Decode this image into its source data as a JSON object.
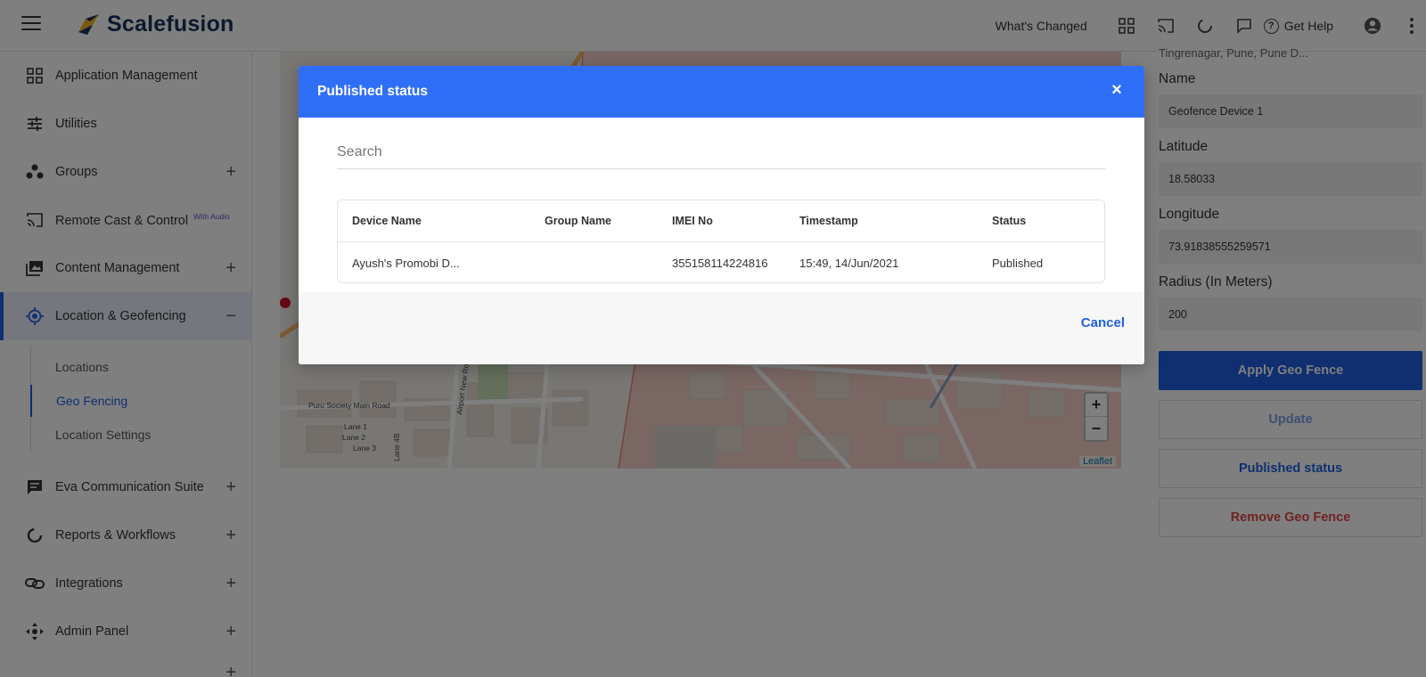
{
  "header": {
    "brand": "Scalefusion",
    "whats_changed": "What's Changed",
    "get_help": "Get Help",
    "icons": [
      "grid-icon",
      "cast-icon",
      "loading-icon",
      "chat-icon",
      "help-icon",
      "account-icon"
    ]
  },
  "sidebar": {
    "items": [
      {
        "label": "Application Management",
        "icon": "apps-grid-icon",
        "expandable": false
      },
      {
        "label": "Utilities",
        "icon": "sliders-icon",
        "expandable": false
      },
      {
        "label": "Groups",
        "icon": "groups-icon",
        "expandable": true
      },
      {
        "label": "Remote Cast & Control",
        "badge": "With Audio",
        "icon": "cast-icon",
        "expandable": false
      },
      {
        "label": "Content Management",
        "icon": "image-stack-icon",
        "expandable": true
      },
      {
        "label": "Location & Geofencing",
        "icon": "location-target-icon",
        "expandable": true,
        "active": true
      },
      {
        "label": "Eva Communication Suite",
        "icon": "chat-icon",
        "expandable": true
      },
      {
        "label": "Reports & Workflows",
        "icon": "report-icon",
        "expandable": true
      },
      {
        "label": "Integrations",
        "icon": "link-icon",
        "expandable": true
      },
      {
        "label": "Admin Panel",
        "icon": "admin-icon",
        "expandable": true
      }
    ],
    "sub_items": [
      {
        "label": "Locations"
      },
      {
        "label": "Geo Fencing",
        "active": true
      },
      {
        "label": "Location Settings"
      }
    ],
    "plus_symbol": "+",
    "minus_symbol": "−"
  },
  "map": {
    "zoom_in": "+",
    "zoom_out": "−",
    "attribution": "Leaflet",
    "labels": [
      "Puru Society Main Road",
      "Airport New Road",
      "Lane 1",
      "Lane 2",
      "Lane 3",
      "Lane 4B"
    ]
  },
  "panel": {
    "address": "Tingrenagar, Pune, Pune D...",
    "name_label": "Name",
    "name_value": "Geofence Device 1",
    "latitude_label": "Latitude",
    "latitude_value": "18.58033",
    "longitude_label": "Longitude",
    "longitude_value": "73.91838555259571",
    "radius_label": "Radius (In Meters)",
    "radius_value": "200",
    "apply_button": "Apply Geo Fence",
    "update_button": "Update",
    "published_button": "Published status",
    "remove_button": "Remove Geo Fence"
  },
  "modal": {
    "title": "Published status",
    "close_symbol": "×",
    "search_placeholder": "Search",
    "columns": [
      "Device Name",
      "Group Name",
      "IMEI No",
      "Timestamp",
      "Status"
    ],
    "rows": [
      {
        "device_name": "Ayush's Promobi D...",
        "group_name": "",
        "imei": "355158114224816",
        "timestamp": "15:49, 14/Jun/2021",
        "status": "Published"
      }
    ],
    "cancel_button": "Cancel"
  },
  "colors": {
    "accent": "#1f5fe0",
    "modal_header": "#2f6ef7",
    "danger": "#e04545",
    "geofence_fill": "#f4c3bc"
  }
}
